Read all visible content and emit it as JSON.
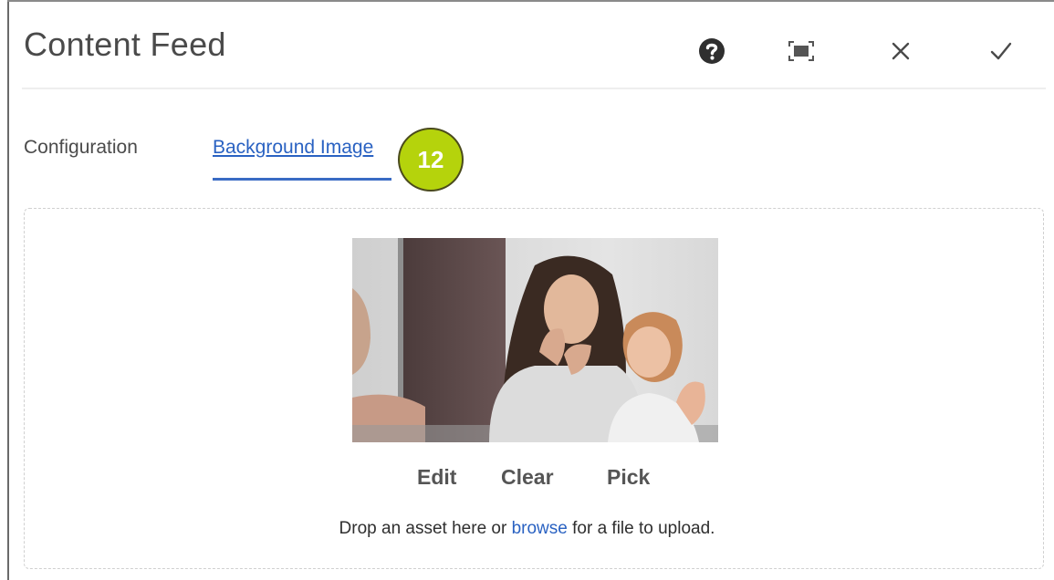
{
  "dialog": {
    "title": "Content Feed",
    "header_buttons": [
      {
        "name": "help-icon",
        "label": "Help"
      },
      {
        "name": "fullscreen-icon",
        "label": "Fullscreen"
      },
      {
        "name": "close-icon",
        "label": "Cancel"
      },
      {
        "name": "checkmark-icon",
        "label": "Done"
      }
    ]
  },
  "tabs": {
    "configuration": "Configuration",
    "background_image": "Background Image",
    "active": "background_image"
  },
  "callout": {
    "number": "12",
    "color": "#b5d30c"
  },
  "image_field": {
    "actions": {
      "edit": "Edit",
      "clear": "Clear",
      "pick": "Pick"
    },
    "hint_before": "Drop an asset here or ",
    "hint_link": "browse",
    "hint_after": " for a file to upload."
  },
  "colors": {
    "accent": "#2a62c2"
  }
}
